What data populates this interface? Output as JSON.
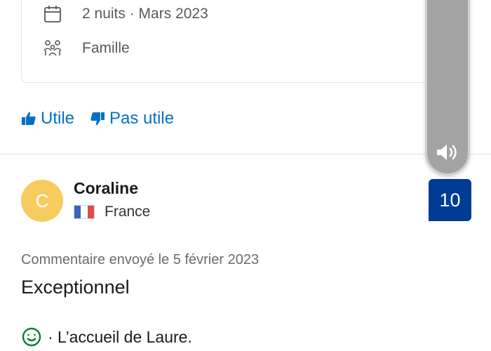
{
  "stay": {
    "dates": "2 nuits · Mars 2023",
    "traveler_type": "Famille"
  },
  "helpful": {
    "useful_label": "Utile",
    "not_useful_label": "Pas utile"
  },
  "review": {
    "avatar_initial": "C",
    "reviewer_name": "Coraline",
    "country": "France",
    "score": "10",
    "date_text": "Commentaire envoyé le 5 février 2023",
    "title": "Exceptionnel",
    "positive_text": "· L’accueil de Laure."
  },
  "colors": {
    "link_blue": "#0071c2",
    "score_bg": "#003b95",
    "avatar_bg": "#f7cc5f",
    "positive_green": "#008234"
  },
  "icons": {
    "calendar": "calendar-icon",
    "family": "group-icon",
    "thumbs_up": "thumbs-up-icon",
    "thumbs_down": "thumbs-down-icon",
    "smile": "smile-icon",
    "speaker": "speaker-icon"
  }
}
